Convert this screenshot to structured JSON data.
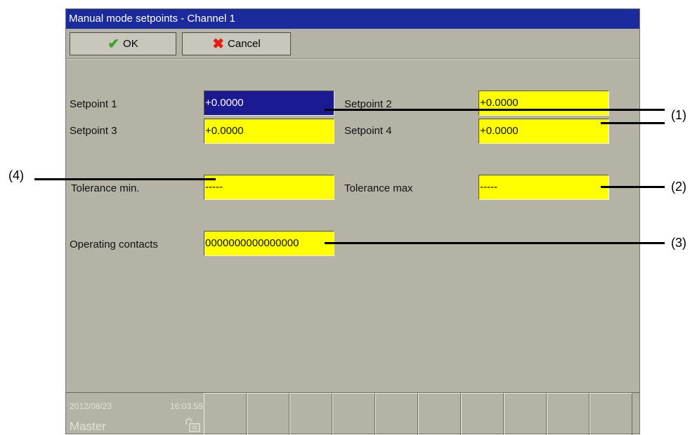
{
  "window": {
    "title": "Manual mode setpoints - Channel 1"
  },
  "toolbar": {
    "ok_label": "OK",
    "ok_icon": "check-icon",
    "ok_icon_color": "#3aa12c",
    "cancel_label": "Cancel",
    "cancel_icon": "x-icon",
    "cancel_icon_color": "#e51a12"
  },
  "form": {
    "setpoint1_label": "Setpoint 1",
    "setpoint1_value": "+0.0000",
    "setpoint2_label": "Setpoint 2",
    "setpoint2_value": "+0.0000",
    "setpoint3_label": "Setpoint 3",
    "setpoint3_value": "+0.0000",
    "setpoint4_label": "Setpoint 4",
    "setpoint4_value": "+0.0000",
    "tolerance_min_label": "Tolerance min.",
    "tolerance_min_value": "-----",
    "tolerance_max_label": "Tolerance max",
    "tolerance_max_value": "-----",
    "operating_contacts_label": "Operating contacts",
    "operating_contacts_value": "0000000000000000"
  },
  "status": {
    "date": "2012/08/23",
    "time": "16:03:59",
    "user": "Master",
    "lock_icon": "lock-open-icon"
  },
  "callouts": {
    "c1": "(1)",
    "c2": "(2)",
    "c3": "(3)",
    "c4": "(4)"
  },
  "colors": {
    "titlebar": "#1c2b9c",
    "field": "#ffff00",
    "field_selected": "#1c1a93",
    "panel": "#b5b3a6"
  }
}
